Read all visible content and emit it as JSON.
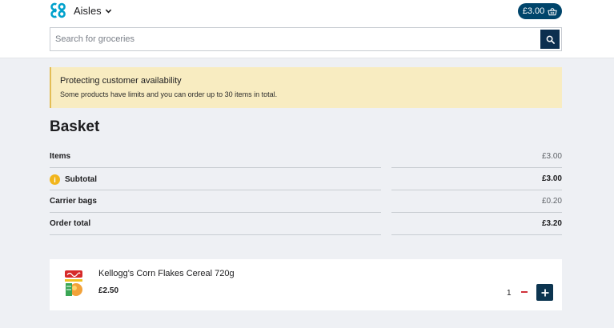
{
  "header": {
    "nav_label": "Aisles",
    "basket_total": "£3.00"
  },
  "search": {
    "placeholder": "Search for groceries",
    "value": ""
  },
  "notice": {
    "title": "Protecting customer availability",
    "text": "Some products have limits and you can order up to 30 items in total."
  },
  "page_title": "Basket",
  "summary": [
    {
      "label": "Items",
      "value": "£3.00"
    },
    {
      "label": "Subtotal",
      "value": "£3.00"
    },
    {
      "label": "Carrier bags",
      "value": "£0.20"
    },
    {
      "label": "Order total",
      "value": "£3.20"
    }
  ],
  "basket_items": [
    {
      "name": "Kellogg's Corn Flakes Cereal 720g",
      "price": "£2.50",
      "quantity": "1"
    }
  ],
  "colors": {
    "brand": "#00456b",
    "notice_bg": "#f8ecc1",
    "info": "#f1b51c",
    "minus": "#d0313a"
  },
  "icons": [
    "coop-logo-icon",
    "chevron-down-icon",
    "basket-icon",
    "search-icon",
    "info-icon",
    "minus-icon",
    "plus-icon"
  ]
}
